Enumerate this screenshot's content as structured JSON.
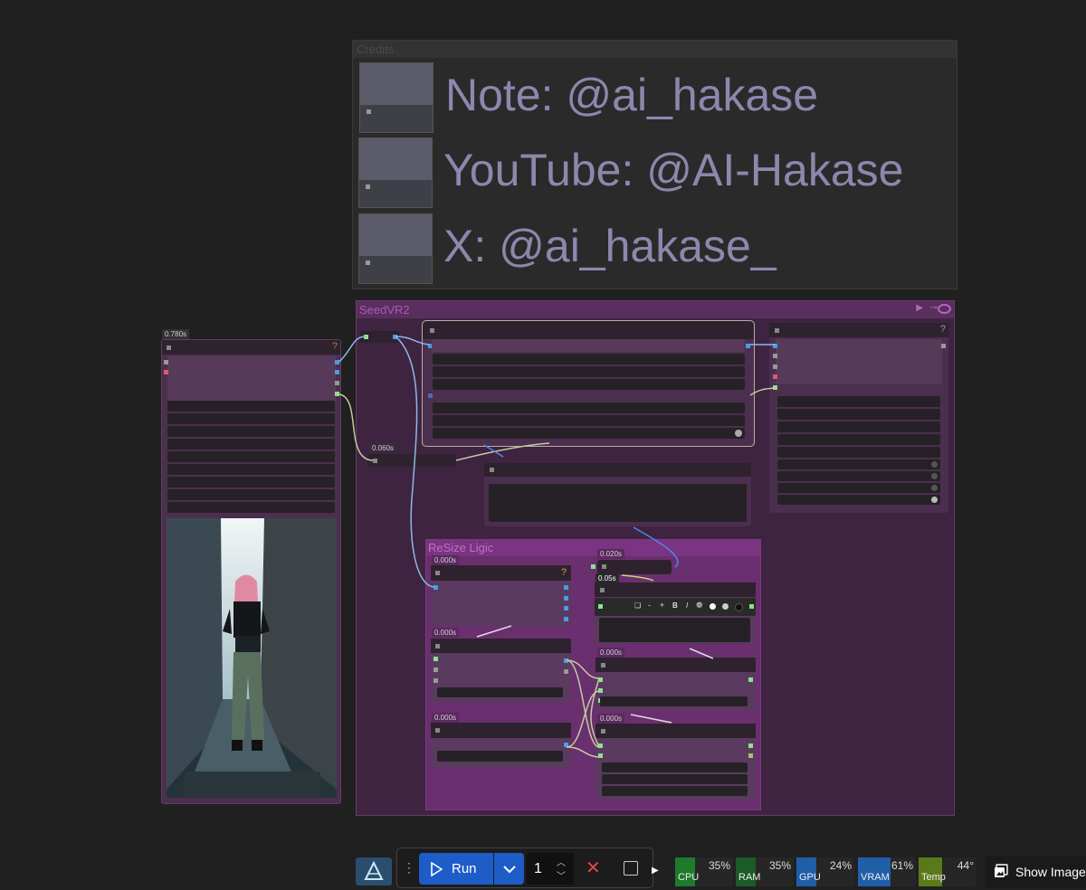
{
  "credits": {
    "title": "Credits",
    "lines": [
      "Note: @ai_hakase",
      "YouTube: @AI-Hakase",
      "X: @ai_hakase_"
    ]
  },
  "groups": {
    "seedvr2": "SeedVR2",
    "resize": "ReSize Ligic"
  },
  "timings": {
    "image_node": "0.780s",
    "small_node": "0.060s",
    "resize_a": "0.000s",
    "resize_b": "0.000s",
    "resize_c": "0.000s",
    "right_a": "0.020s",
    "right_b": "0.05s",
    "right_c": "0.000s",
    "right_d": "0.000s"
  },
  "help_glyph": "?",
  "format_toolbar": [
    "❏",
    "-",
    "+",
    "B",
    "I",
    "❁"
  ],
  "actionbar": {
    "run_label": "Run",
    "batch_count": "1"
  },
  "stats": [
    {
      "label": "CPU",
      "value": "35%",
      "fill": 0.35,
      "color": "#1f7a2a"
    },
    {
      "label": "RAM",
      "value": "35%",
      "fill": 0.35,
      "color": "#1c5a28"
    },
    {
      "label": "GPU",
      "value": "24%",
      "fill": 0.24,
      "color": "#1e5fa8"
    },
    {
      "label": "VRAM",
      "value": "61%",
      "fill": 0.61,
      "color": "#1e5fa8"
    },
    {
      "label": "Temp",
      "value": "44°",
      "fill": 0.44,
      "color": "#5a7a1a"
    }
  ],
  "show_image_label": "Show Image",
  "colors": {
    "canvas": "#202020",
    "group": "#3e2440",
    "group_title": "#a85ab0",
    "credit_text": "#8f86ad",
    "run_button": "#1e5cc8"
  }
}
